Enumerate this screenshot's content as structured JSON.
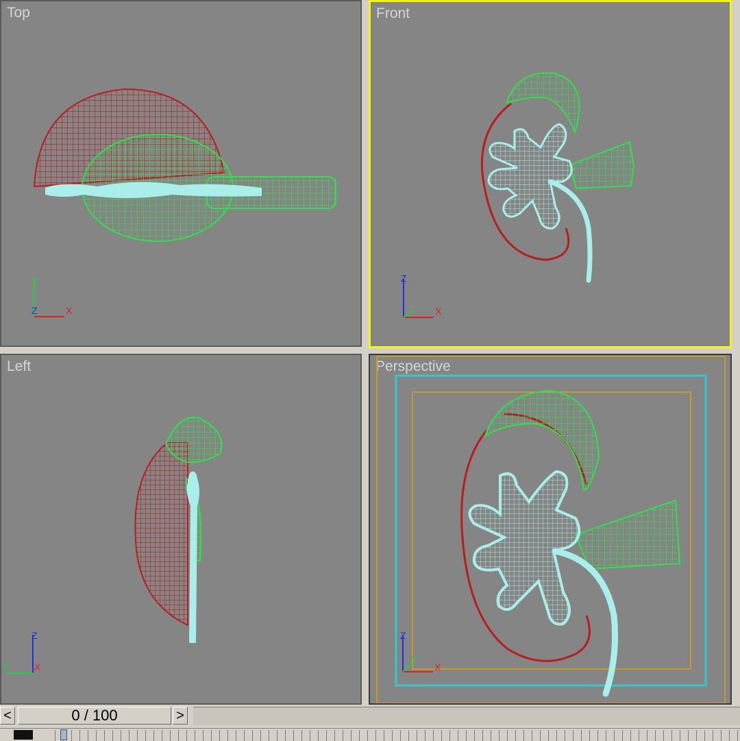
{
  "viewports": {
    "top": {
      "label": "Top",
      "axes": {
        "a": "Y",
        "b": "X",
        "c": "Z"
      }
    },
    "front": {
      "label": "Front",
      "axes": {
        "a": "Z",
        "b": "X",
        "c": ""
      }
    },
    "left": {
      "label": "Left",
      "axes": {
        "a": "Z",
        "b": "X",
        "c": "Y"
      }
    },
    "perspective": {
      "label": "Perspective",
      "axes": {
        "a": "Z",
        "b": "X",
        "c": "Y"
      }
    }
  },
  "active_viewport": "front",
  "timebar": {
    "prev_label": "<",
    "next_label": ">",
    "frame_text": "0 / 100"
  },
  "colors": {
    "viewport_bg": "#858585",
    "active_border": "#f5f21a",
    "cortex_red": "#b81e1e",
    "vessel_green": "#2fe04a",
    "ureter_cyan": "#a9eeea",
    "safe_frame_cyan": "#35c7cf",
    "safe_frame_orange": "#c59a2a",
    "axis_x": "#e02020",
    "axis_y": "#20d040",
    "axis_z": "#2030e0"
  },
  "icons": {
    "prev": "chevron-left-icon",
    "next": "chevron-right-icon",
    "key": "key-mode-icon"
  }
}
